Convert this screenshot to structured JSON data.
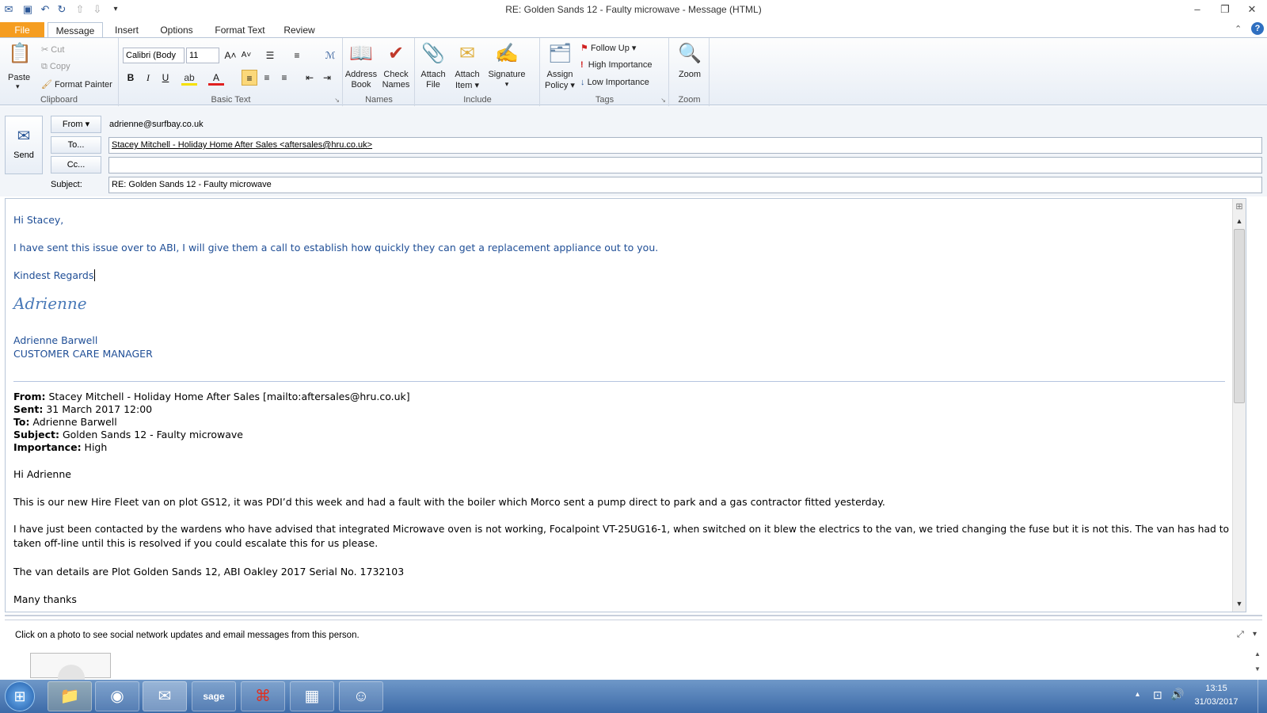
{
  "window": {
    "title": "RE: Golden Sands 12 - Faulty microwave  -  Message (HTML)"
  },
  "quick_access": {
    "icons": [
      "save-icon",
      "undo-icon",
      "redo-icon",
      "up-icon",
      "down-icon",
      "customize-icon"
    ]
  },
  "tabs": [
    {
      "label": "File"
    },
    {
      "label": "Message"
    },
    {
      "label": "Insert"
    },
    {
      "label": "Options"
    },
    {
      "label": "Format Text"
    },
    {
      "label": "Review"
    }
  ],
  "ribbon": {
    "clipboard": {
      "label": "Clipboard",
      "paste": "Paste",
      "cut": "Cut",
      "copy": "Copy",
      "format_painter": "Format Painter"
    },
    "basic_text": {
      "label": "Basic Text",
      "font": "Calibri (Body",
      "size": "11",
      "bold": "B",
      "italic": "I",
      "underline": "U",
      "grow": "A˄",
      "shrink": "A˅"
    },
    "names": {
      "label": "Names",
      "address_book_1": "Address",
      "address_book_2": "Book",
      "check_names_1": "Check",
      "check_names_2": "Names"
    },
    "include": {
      "label": "Include",
      "attach_file_1": "Attach",
      "attach_file_2": "File",
      "attach_item_1": "Attach",
      "attach_item_2": "Item ▾",
      "signature": "Signature"
    },
    "tags": {
      "label": "Tags",
      "assign_policy_1": "Assign",
      "assign_policy_2": "Policy ▾",
      "follow_up": "Follow Up ▾",
      "high_importance": "High Importance",
      "low_importance": "Low Importance"
    },
    "zoom": {
      "label": "Zoom",
      "zoom": "Zoom"
    }
  },
  "compose": {
    "send": "Send",
    "from_btn": "From ▾",
    "from_value": "adrienne@surfbay.co.uk",
    "to_btn": "To...",
    "to_value": "Stacey Mitchell - Holiday Home After Sales <aftersales@hru.co.uk>",
    "cc_btn": "Cc...",
    "cc_value": "",
    "subject_label": "Subject:",
    "subject_value": "RE: Golden Sands 12 - Faulty microwave"
  },
  "body": {
    "greeting": "Hi Stacey,",
    "line1": "I have sent this issue over to ABI, I will give them a call to establish how quickly they can get a replacement appliance out to you.",
    "regards": "Kindest Regards",
    "signature_script": "Adrienne",
    "sig_name": "Adrienne Barwell",
    "sig_title": "CUSTOMER CARE MANAGER",
    "quoted": {
      "from_label": "From:",
      "from": " Stacey Mitchell - Holiday Home After Sales [mailto:aftersales@hru.co.uk]",
      "sent_label": "Sent:",
      "sent": " 31 March 2017 12:00",
      "to_label": "To:",
      "to": " Adrienne Barwell",
      "subject_label": "Subject:",
      "subject": " Golden Sands 12 - Faulty microwave",
      "importance_label": "Importance:",
      "importance": " High",
      "greeting": "Hi Adrienne",
      "p1": "This is our new Hire Fleet van on plot GS12, it was PDI’d this week and had a fault with the boiler which Morco sent a pump direct to park and a gas contractor fitted yesterday.",
      "p2a": "I have just been contacted by the wardens who have advised that integrated Microwave oven is not working, Focalpoint VT-25UG16-1, when switched on it blew the electrics to the van, we tried changing the fuse but it is not this. The van has had to be",
      "p2b": "taken off-line until this is resolved if you could escalate this for us please.",
      "p3": "The van details are Plot Golden Sands 12, ABI Oakley 2017 Serial No. 1732103",
      "closing": "Many thanks"
    }
  },
  "people_pane": {
    "message": "Click on a photo to see social network updates and email messages from this person."
  },
  "taskbar": {
    "time": "13:15",
    "date": "31/03/2017"
  }
}
